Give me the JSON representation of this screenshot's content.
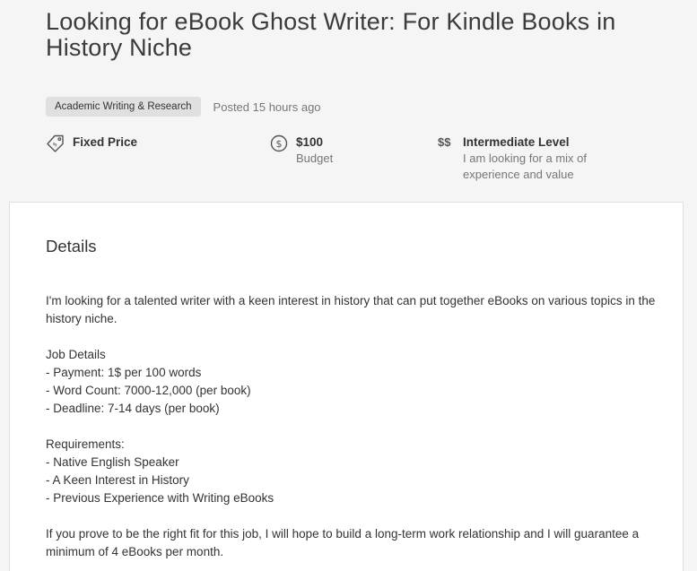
{
  "job": {
    "title": "Looking for eBook Ghost Writer: For Kindle Books in History Niche",
    "category": "Academic Writing & Research",
    "posted": "Posted 15 hours ago"
  },
  "features": {
    "price_type": {
      "label": "Fixed Price",
      "icon": "price-tag-icon"
    },
    "budget": {
      "amount": "$100",
      "label": "Budget",
      "icon": "dollar-circle-icon"
    },
    "level": {
      "icon_text": "$$",
      "label": "Intermediate Level",
      "description": "I am looking for a mix of experience and value"
    }
  },
  "details": {
    "heading": "Details",
    "intro": "I'm looking for a talented writer with a keen interest in history that can put together eBooks on various topics in the history niche.",
    "job_details_title": "Job Details",
    "job_details": [
      "- Payment: 1$ per 100 words",
      "- Word Count: 7000-12,000 (per book)",
      "- Deadline: 7-14 days (per book)"
    ],
    "requirements_title": "Requirements:",
    "requirements": [
      "- Native English Speaker",
      "- A Keen Interest in History",
      "- Previous Experience with Writing eBooks"
    ],
    "closing": "If you prove to be the right fit for this job, I will hope to build a long-term work relationship and I will guarantee a minimum of 4 eBooks per month."
  }
}
